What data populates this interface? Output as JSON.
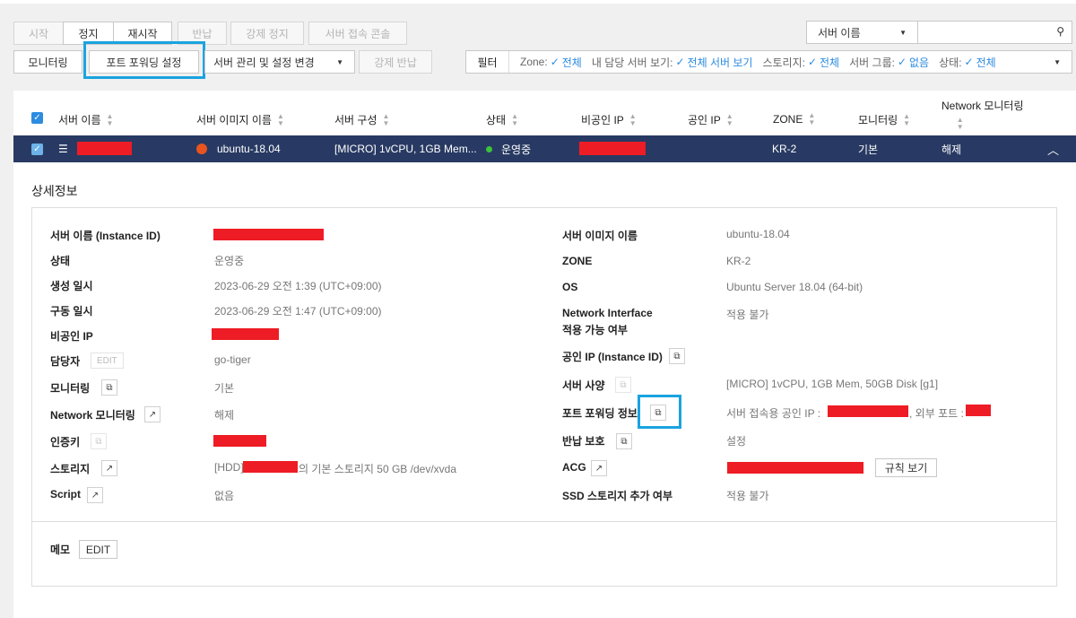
{
  "toolbar": {
    "row1": [
      {
        "label": "시작",
        "disabled": true
      },
      {
        "label": "정지",
        "disabled": false
      },
      {
        "label": "재시작",
        "disabled": false
      },
      {
        "label": "반납",
        "disabled": true
      },
      {
        "label": "강제 정지",
        "disabled": true
      },
      {
        "label": "서버 접속 콘솔",
        "disabled": true
      }
    ],
    "monitoring": "모니터링",
    "port_forwarding": "포트 포워딩 설정",
    "server_manage": "서버 관리 및 설정 변경",
    "force_return": "강제 반납",
    "search_select": "서버 이름",
    "search_placeholder": ""
  },
  "filter": {
    "label": "필터",
    "items": [
      {
        "key": "Zone:",
        "value": "전체"
      },
      {
        "key": "내 담당 서버 보기:",
        "value": "전체 서버 보기"
      },
      {
        "key": "스토리지:",
        "value": "전체"
      },
      {
        "key": "서버 그룹:",
        "value": "없음"
      },
      {
        "key": "상태:",
        "value": "전체"
      }
    ]
  },
  "table": {
    "headers": [
      "서버 이름",
      "서버 이미지 이름",
      "서버 구성",
      "상태",
      "비공인 IP",
      "공인 IP",
      "ZONE",
      "모니터링",
      "Network 모니터링"
    ],
    "row": {
      "image": "ubuntu-18.04",
      "spec": "[MICRO] 1vCPU, 1GB Mem...",
      "status": "운영중",
      "zone": "KR-2",
      "monitoring": "기본",
      "network_monitoring": "해제"
    }
  },
  "detail": {
    "title": "상세정보",
    "left": {
      "instance_label": "서버 이름 (Instance ID)",
      "status_label": "상태",
      "status_value": "운영중",
      "created_label": "생성 일시",
      "created_value": "2023-06-29 오전 1:39 (UTC+09:00)",
      "started_label": "구동 일시",
      "started_value": "2023-06-29 오전 1:47 (UTC+09:00)",
      "private_ip_label": "비공인 IP",
      "owner_label": "담당자",
      "owner_edit": "EDIT",
      "owner_value": "go-tiger",
      "monitoring_label": "모니터링",
      "monitoring_value": "기본",
      "netmon_label": "Network 모니터링",
      "netmon_value": "해제",
      "authkey_label": "인증키",
      "storage_label": "스토리지",
      "storage_prefix": "[HDD]",
      "storage_suffix": "의 기본 스토리지  50 GB /dev/xvda",
      "script_label": "Script",
      "script_value": "없음"
    },
    "right": {
      "image_label": "서버 이미지 이름",
      "image_value": "ubuntu-18.04",
      "zone_label": "ZONE",
      "zone_value": "KR-2",
      "os_label": "OS",
      "os_value": "Ubuntu Server 18.04 (64-bit)",
      "ni_label_1": "Network Interface",
      "ni_label_2": "적용 가능 여부",
      "ni_value": "적용 불가",
      "public_ip_label": "공인 IP (Instance ID)",
      "spec_label": "서버 사양",
      "spec_value": "[MICRO] 1vCPU, 1GB Mem, 50GB Disk [g1]",
      "pf_label": "포트 포워딩 정보",
      "pf_value_1": "서버 접속용 공인 IP :",
      "pf_value_2": ", 외부 포트 :",
      "return_label": "반납 보호",
      "return_value": "설정",
      "acg_label": "ACG",
      "acg_button": "규칙 보기",
      "ssd_label": "SSD 스토리지 추가 여부",
      "ssd_value": "적용 불가"
    },
    "memo_label": "메모",
    "memo_edit": "EDIT"
  }
}
